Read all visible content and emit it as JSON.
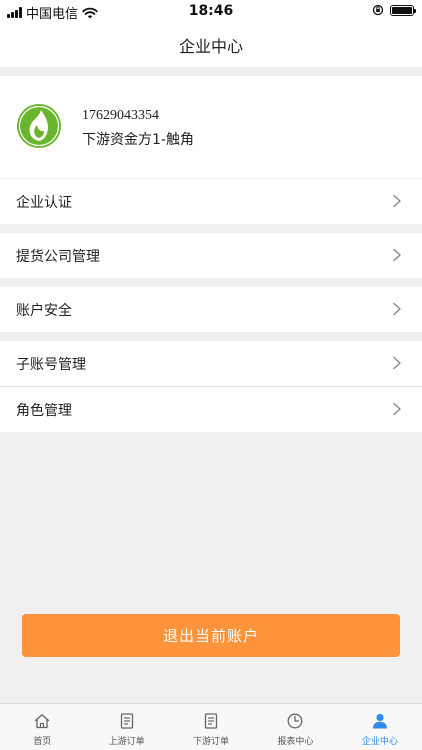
{
  "status_bar": {
    "carrier": "中国电信",
    "time": "18:46"
  },
  "header": {
    "title": "企业中心"
  },
  "profile": {
    "phone": "17629043354",
    "company": "下游资金方1-触角"
  },
  "menu": [
    {
      "label": "企业认证"
    },
    {
      "label": "提货公司管理"
    },
    {
      "label": "账户安全"
    },
    {
      "label": "子账号管理"
    },
    {
      "label": "角色管理"
    }
  ],
  "logout_label": "退出当前账户",
  "tabs": [
    {
      "label": "首页",
      "icon": "home-icon",
      "active": false
    },
    {
      "label": "上游订单",
      "icon": "document-icon",
      "active": false
    },
    {
      "label": "下游订单",
      "icon": "document-icon",
      "active": false
    },
    {
      "label": "报表中心",
      "icon": "clock-icon",
      "active": false
    },
    {
      "label": "企业中心",
      "icon": "user-icon",
      "active": true
    }
  ],
  "colors": {
    "accent": "#fd933a",
    "active_tab": "#2f8be8",
    "logo_green": "#6ab42e"
  }
}
